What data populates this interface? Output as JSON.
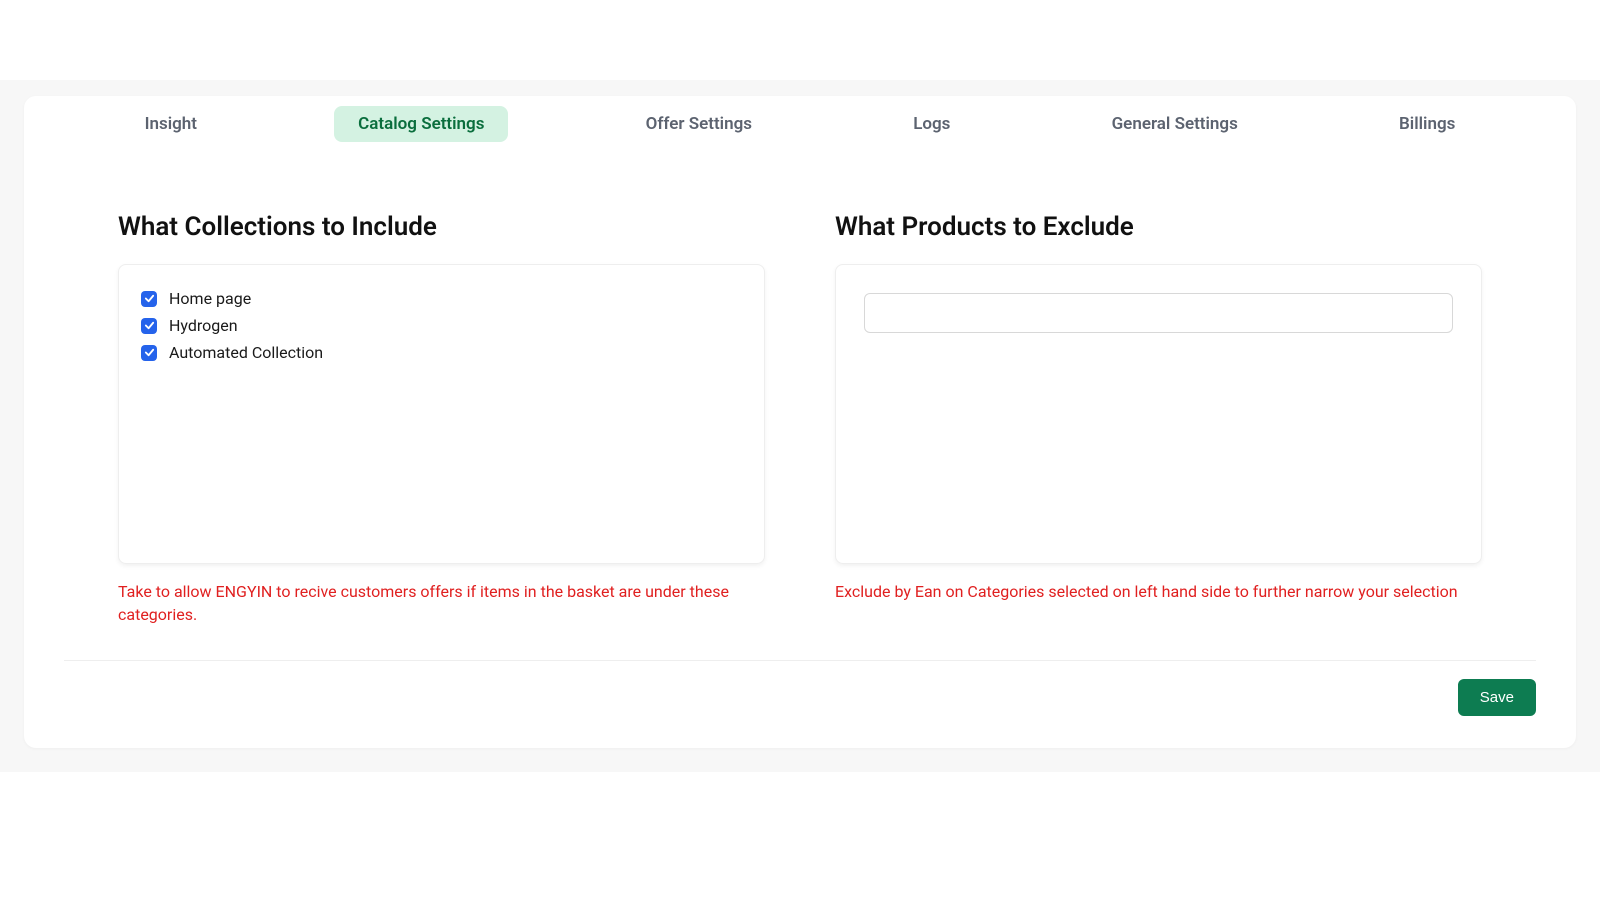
{
  "tabs": [
    {
      "label": "Insight",
      "active": false
    },
    {
      "label": "Catalog Settings",
      "active": true
    },
    {
      "label": "Offer Settings",
      "active": false
    },
    {
      "label": "Logs",
      "active": false
    },
    {
      "label": "General Settings",
      "active": false
    },
    {
      "label": "Billings",
      "active": false
    }
  ],
  "include": {
    "title": "What Collections to Include",
    "items": [
      {
        "label": "Home page",
        "checked": true
      },
      {
        "label": "Hydrogen",
        "checked": true
      },
      {
        "label": "Automated Collection",
        "checked": true
      }
    ],
    "help": "Take to allow ENGYIN to recive customers offers if items in the basket are under these categories."
  },
  "exclude": {
    "title": "What Products to Exclude",
    "input_value": "",
    "help": "Exclude by Ean on Categories selected on left hand side to further narrow your selection"
  },
  "footer": {
    "save_label": "Save"
  }
}
